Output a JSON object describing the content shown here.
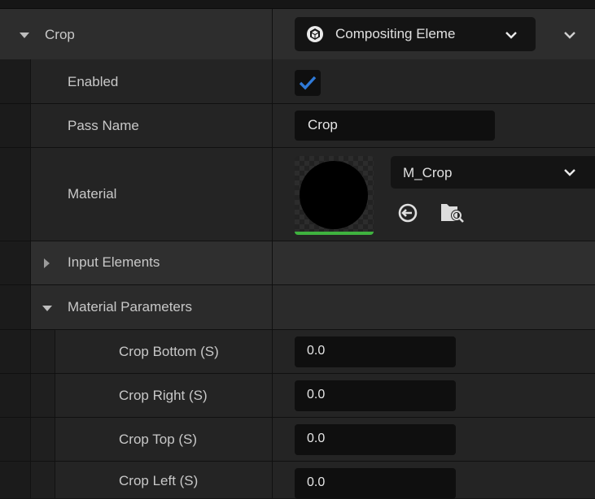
{
  "header": {
    "section_label": "Crop",
    "class_dropdown": "Compositing Eleme"
  },
  "properties": {
    "enabled": {
      "label": "Enabled",
      "checked": true
    },
    "pass_name": {
      "label": "Pass Name",
      "value": "Crop"
    },
    "material": {
      "label": "Material",
      "asset": "M_Crop"
    },
    "input_elements": {
      "label": "Input Elements"
    },
    "material_parameters": {
      "label": "Material Parameters"
    }
  },
  "params": [
    {
      "label": "Crop Bottom (S)",
      "value": "0.0"
    },
    {
      "label": "Crop Right (S)",
      "value": "0.0"
    },
    {
      "label": "Crop Top (S)",
      "value": "0.0"
    },
    {
      "label": "Crop Left (S)",
      "value": "0.0"
    }
  ],
  "colors": {
    "checkbox_accent": "#2f7ad8",
    "material_underline": "#3fb23f"
  }
}
